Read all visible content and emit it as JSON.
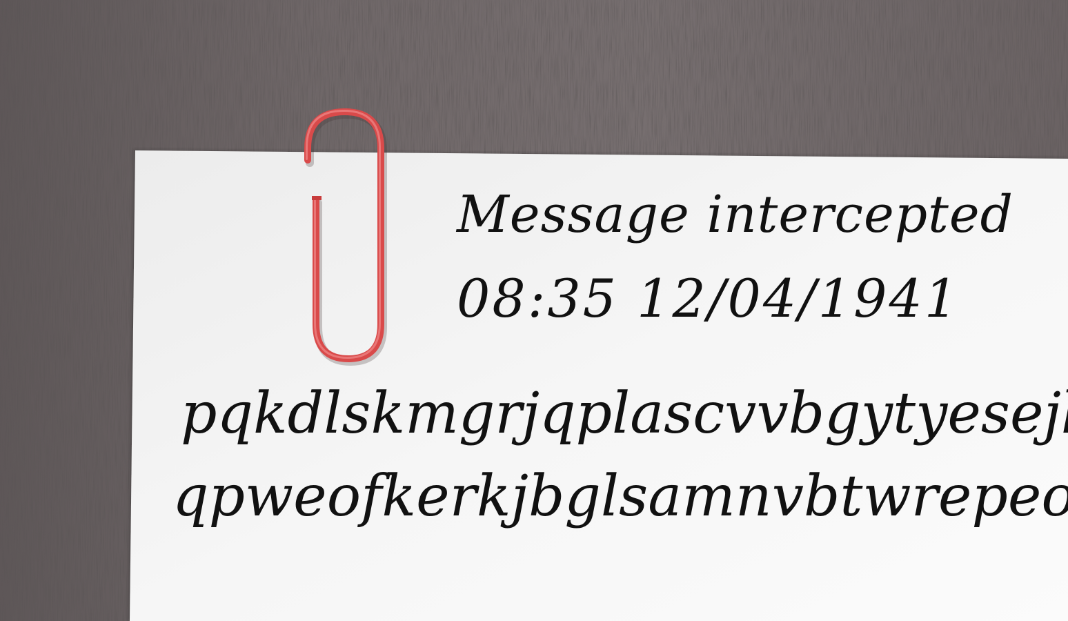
{
  "note": {
    "line1": "Message intercepted",
    "line2": "08:35 12/04/1941",
    "line3": "pqkdlskmgrjqplascvvbgytyesejklv",
    "line4": "qpweofkerkjbglsamnvbtwrepeoth"
  },
  "colors": {
    "wood": "#6b6364",
    "paper": "#f7f7f7",
    "ink": "#111111",
    "clip": "#d94a4a"
  },
  "objects": [
    "wood-background",
    "paper-sheet",
    "red-paperclip"
  ]
}
